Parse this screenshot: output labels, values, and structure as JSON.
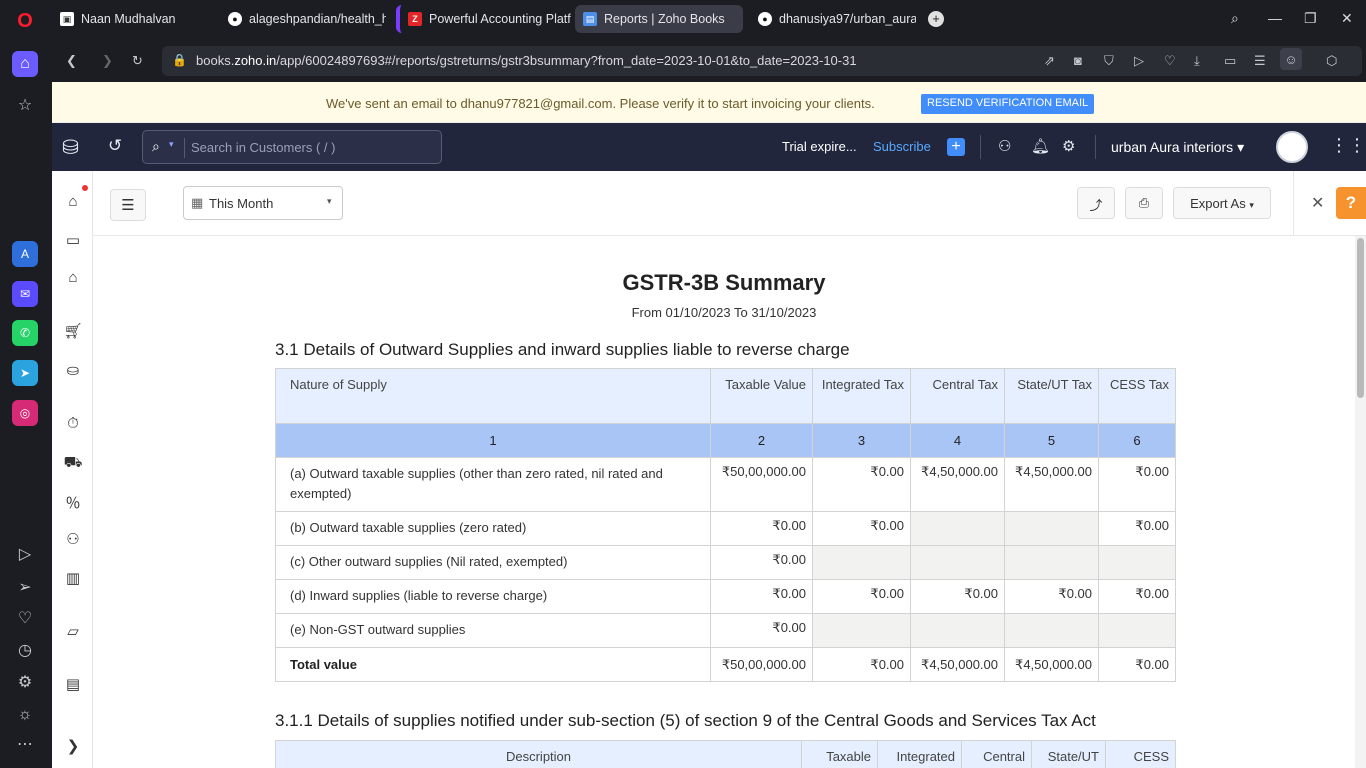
{
  "browser": {
    "tabs": [
      {
        "title": "Naan Mudhalvan",
        "icon": "naan-mudhalvan-icon"
      },
      {
        "title": "alageshpandian/health_h",
        "icon": "github-icon"
      },
      {
        "title": "Powerful Accounting Platf",
        "icon": "zoho-z-icon"
      },
      {
        "title": "Reports | Zoho Books",
        "icon": "zoho-books-icon"
      },
      {
        "title": "dhanusiya97/urban_aura_",
        "icon": "github-icon"
      }
    ],
    "url_prefix": "books.",
    "url_domain": "zoho.in",
    "url_path": "/app/60024897693#/reports/gstreturns/gstr3bsummary?from_date=2023-10-01&to_date=2023-10-31"
  },
  "banner": {
    "text": "We've sent an email to dhanu977821@gmail.com. Please verify it to start invoicing your clients.",
    "button": "RESEND VERIFICATION EMAIL"
  },
  "header": {
    "search_placeholder": "Search in Customers ( / )",
    "trial": "Trial expire...",
    "subscribe": "Subscribe",
    "org": "urban Aura interiors"
  },
  "toolbar": {
    "period": "This Month",
    "export": "Export As",
    "help": "?"
  },
  "report": {
    "title": "GSTR-3B Summary",
    "range": "From 01/10/2023  To 31/10/2023",
    "section1": "3.1 Details of Outward Supplies and inward supplies liable to reverse charge",
    "section2": "3.1.1 Details of supplies notified under sub-section (5) of section 9 of the Central Goods and Services Tax Act",
    "headers": [
      "Nature of Supply",
      "Taxable Value",
      "Integrated Tax",
      "Central Tax",
      "State/UT Tax",
      "CESS Tax"
    ],
    "index": [
      "1",
      "2",
      "3",
      "4",
      "5",
      "6"
    ],
    "rows": [
      [
        "(a) Outward taxable supplies (other than zero rated, nil rated and exempted)",
        "₹50,00,000.00",
        "₹0.00",
        "₹4,50,000.00",
        "₹4,50,000.00",
        "₹0.00"
      ],
      [
        "(b) Outward taxable supplies (zero rated)",
        "₹0.00",
        "₹0.00",
        "",
        "",
        "₹0.00"
      ],
      [
        "(c) Other outward supplies (Nil rated, exempted)",
        "₹0.00",
        "",
        "",
        "",
        ""
      ],
      [
        "(d) Inward supplies (liable to reverse charge)",
        "₹0.00",
        "₹0.00",
        "₹0.00",
        "₹0.00",
        "₹0.00"
      ],
      [
        "(e) Non-GST outward supplies",
        "₹0.00",
        "",
        "",
        "",
        ""
      ]
    ],
    "total": [
      "Total value",
      "₹50,00,000.00",
      "₹0.00",
      "₹4,50,000.00",
      "₹4,50,000.00",
      "₹0.00"
    ],
    "headers2": [
      "Description",
      "Taxable",
      "Integrated",
      "Central",
      "State/UT",
      "CESS"
    ]
  },
  "colors": {
    "accent": "#408dfb",
    "header_bg": "#21263c",
    "index_row": "#a8c5f5",
    "header_row": "#e5efff",
    "help": "#f7932f"
  }
}
